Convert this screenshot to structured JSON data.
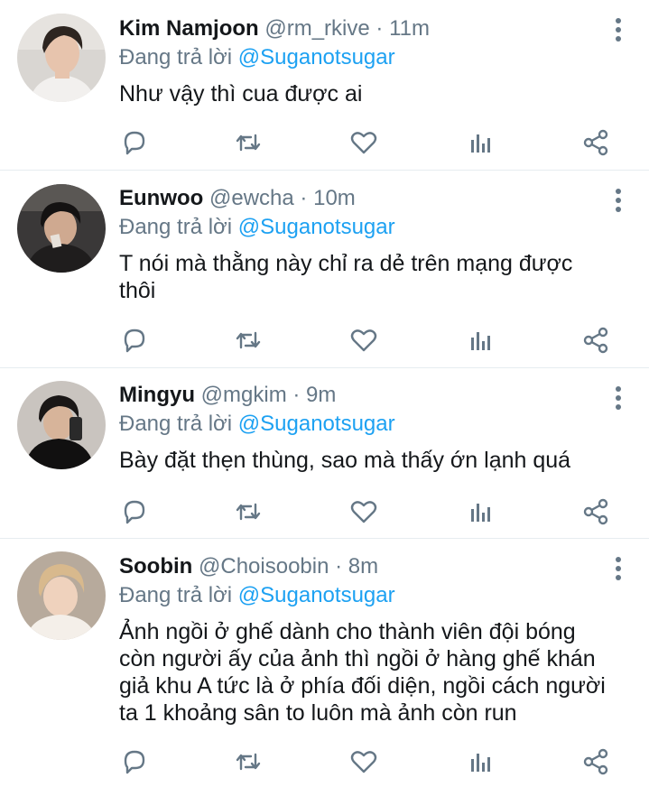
{
  "tweets": [
    {
      "name": "Kim Namjoon",
      "handle": "@rm_rkive",
      "dot": "·",
      "time": "11m",
      "reply_prefix": "Đang trả lời",
      "reply_to": "@Suganotsugar",
      "text": "Như vậy thì cua được ai"
    },
    {
      "name": "Eunwoo",
      "handle": "@ewcha",
      "dot": "·",
      "time": "10m",
      "reply_prefix": "Đang trả lời",
      "reply_to": "@Suganotsugar",
      "text": "T nói mà thằng này chỉ ra dẻ trên mạng được thôi"
    },
    {
      "name": "Mingyu",
      "handle": "@mgkim",
      "dot": "·",
      "time": "9m",
      "reply_prefix": "Đang trả lời",
      "reply_to": "@Suganotsugar",
      "text": "Bày đặt thẹn thùng, sao mà thấy ớn lạnh quá"
    },
    {
      "name": "Soobin",
      "handle": "@Choisoobin",
      "dot": "·",
      "time": "8m",
      "reply_prefix": "Đang trả lời",
      "reply_to": "@Suganotsugar",
      "text": "Ảnh ngồi ở ghế dành cho thành viên đội bóng còn người ấy của ảnh thì ngồi ở hàng ghế khán giả khu A tức là ở phía đối diện, ngồi cách người ta 1 khoảng sân to luôn mà ảnh còn run"
    }
  ],
  "icons": {
    "reply": "reply-icon",
    "retweet": "retweet-icon",
    "like": "heart-icon",
    "stats": "stats-icon",
    "share": "share-icon",
    "more": "more-vertical-icon"
  },
  "colors": {
    "text": "#14171a",
    "secondary": "#657786",
    "link": "#1da1f2",
    "divider": "#e6ecf0"
  }
}
